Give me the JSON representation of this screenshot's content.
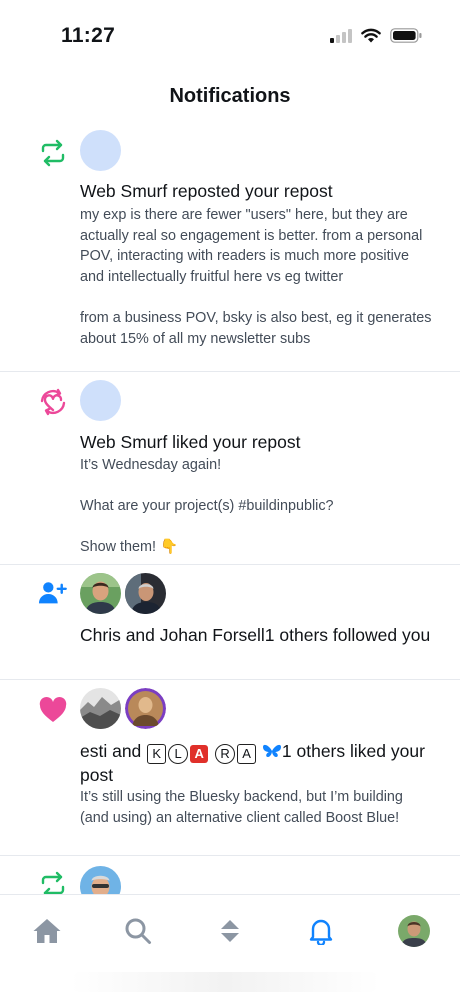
{
  "status_bar": {
    "time": "11:27"
  },
  "header": {
    "title": "Notifications"
  },
  "notifications": [
    {
      "type": "repost",
      "icon": "repost-icon",
      "title": "Web Smurf reposted your repost",
      "body": "my exp is there are fewer \"users\" here, but they are actually real so engagement is better. from a personal POV, interacting with readers is much more positive and intellectually fruitful here vs eg twitter\n\nfrom a business POV, bsky is also best, eg it generates about 15% of all my newsletter subs"
    },
    {
      "type": "like-repost",
      "icon": "repost-heart-icon",
      "title": "Web Smurf liked your repost",
      "body": "It’s Wednesday again!\n\nWhat are your project(s) #buildinpublic?\n\nShow them! 👇"
    },
    {
      "type": "follow",
      "icon": "person-add-icon",
      "title": "Chris and Johan Forsell1 others followed you"
    },
    {
      "type": "like",
      "icon": "heart-icon",
      "title_prefix": "esti and ",
      "title_letters": [
        "K",
        "L",
        "A",
        "R",
        "A"
      ],
      "title_suffix": "1 others liked your post",
      "body": "It’s still using the Bluesky backend, but I’m building (and using) an alternative client called Boost Blue!"
    },
    {
      "type": "repost",
      "icon": "repost-icon"
    }
  ],
  "bottom_nav": [
    "home-icon",
    "search-icon",
    "feeds-icon",
    "bell-icon",
    "profile-avatar"
  ],
  "colors": {
    "repost_green": "#20bc65",
    "like_pink": "#ec4899",
    "accent_blue": "#1083fe",
    "nav_gray": "#8c96a3"
  }
}
